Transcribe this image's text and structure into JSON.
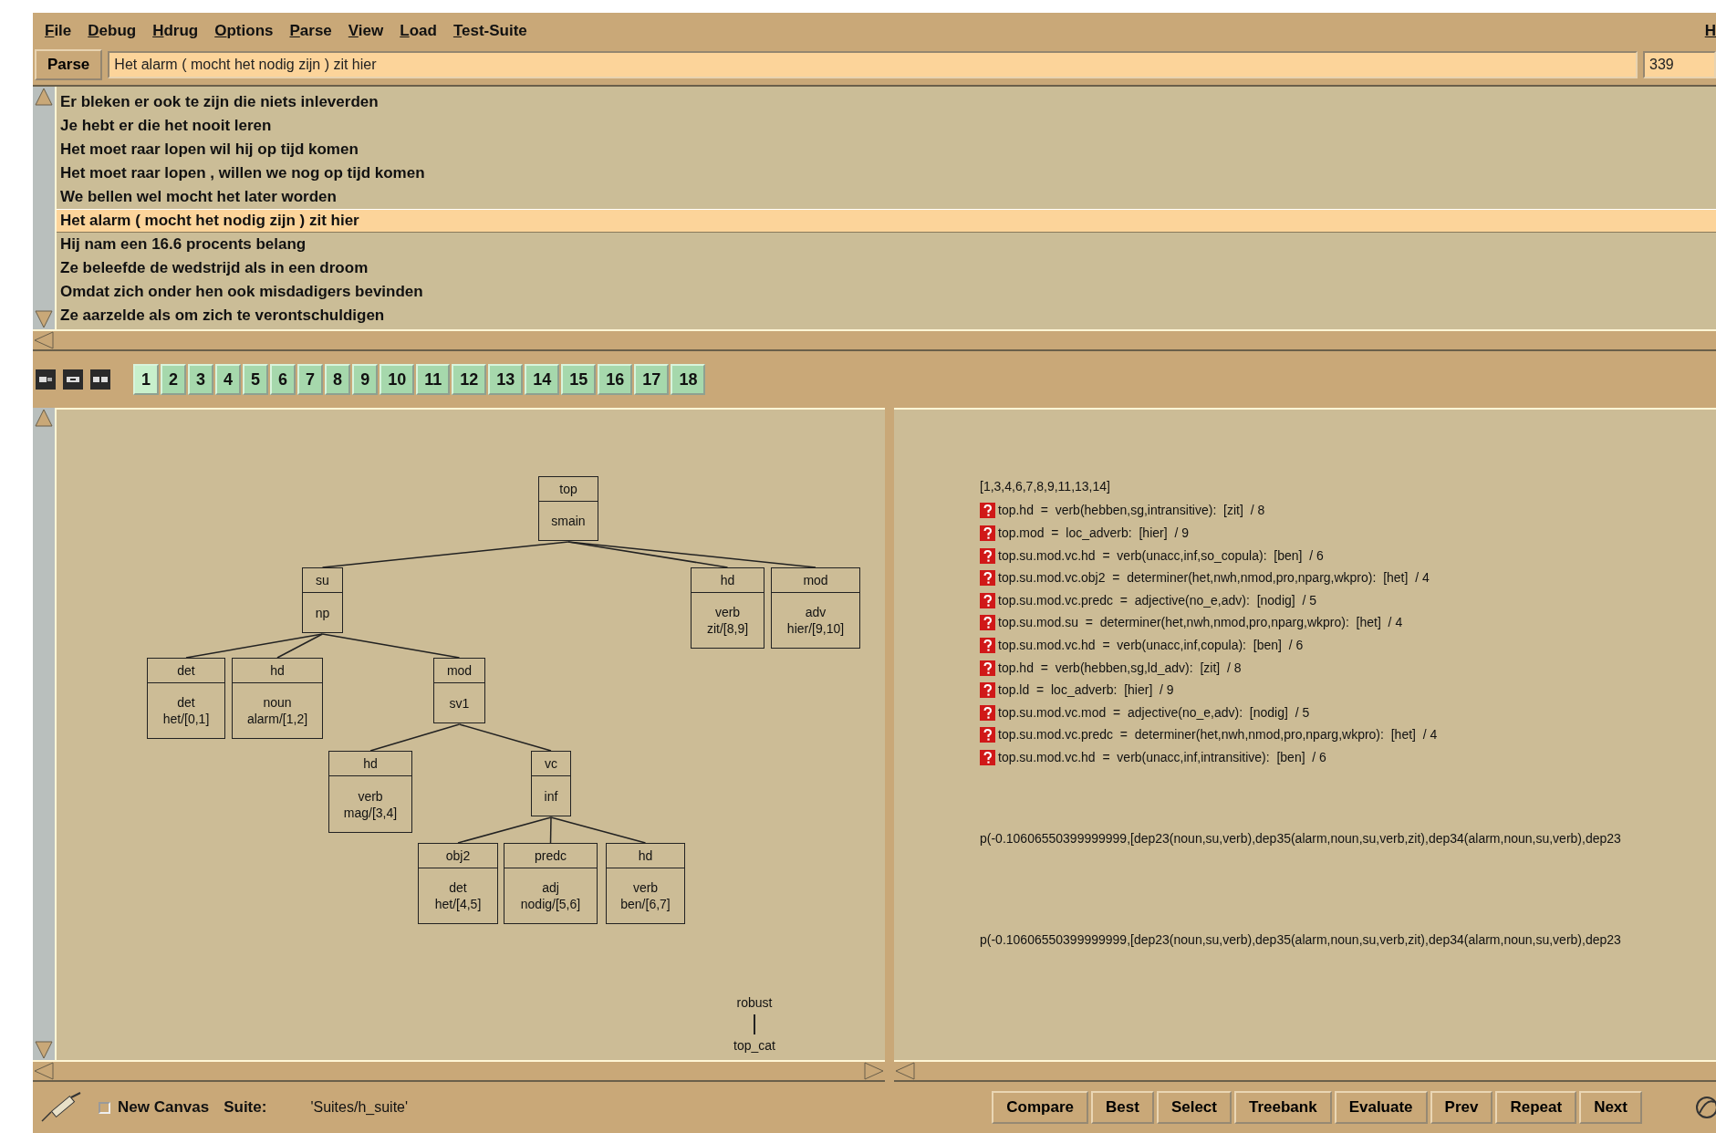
{
  "menu": [
    {
      "label": "File"
    },
    {
      "label": "Debug"
    },
    {
      "label": "Hdrug"
    },
    {
      "label": "Options"
    },
    {
      "label": "Parse"
    },
    {
      "label": "View"
    },
    {
      "label": "Load"
    },
    {
      "label": "Test-Suite"
    }
  ],
  "help_menu": "H",
  "parse": {
    "button": "Parse",
    "value": "Het alarm ( mocht het nodig zijn ) zit hier",
    "count": "339"
  },
  "sentences": [
    {
      "text": "Er bleken er ook te zijn die niets inleverden",
      "selected": false
    },
    {
      "text": "Je hebt er die het nooit leren",
      "selected": false
    },
    {
      "text": "Het moet raar lopen wil hij op tijd komen",
      "selected": false
    },
    {
      "text": "Het moet raar lopen , willen we nog op tijd komen",
      "selected": false
    },
    {
      "text": "We bellen wel mocht het later worden",
      "selected": false
    },
    {
      "text": "Het alarm ( mocht het nodig zijn ) zit hier",
      "selected": true
    },
    {
      "text": "Hij nam een 16.6 procents belang",
      "selected": false
    },
    {
      "text": "Ze beleefde de wedstrijd als in een droom",
      "selected": false
    },
    {
      "text": "Omdat zich onder hen ook misdadigers bevinden",
      "selected": false
    },
    {
      "text": "Ze aarzelde als om zich te verontschuldigen",
      "selected": false
    }
  ],
  "tabs": [
    {
      "label": "1",
      "selected": true
    },
    {
      "label": "2",
      "selected": false
    },
    {
      "label": "3",
      "selected": false
    },
    {
      "label": "4",
      "selected": false
    },
    {
      "label": "5",
      "selected": false
    },
    {
      "label": "6",
      "selected": false
    },
    {
      "label": "7",
      "selected": false
    },
    {
      "label": "8",
      "selected": false
    },
    {
      "label": "9",
      "selected": false
    },
    {
      "label": "10",
      "selected": false
    },
    {
      "label": "11",
      "selected": false
    },
    {
      "label": "12",
      "selected": false
    },
    {
      "label": "13",
      "selected": false
    },
    {
      "label": "14",
      "selected": false
    },
    {
      "label": "15",
      "selected": false
    },
    {
      "label": "16",
      "selected": false
    },
    {
      "label": "17",
      "selected": false
    },
    {
      "label": "18",
      "selected": false
    }
  ],
  "tree": {
    "rel": "top",
    "cat": "smain",
    "children": [
      {
        "rel": "su",
        "cat": "np",
        "children": [
          {
            "rel": "det",
            "cat": "det",
            "word": "het/[0,1]"
          },
          {
            "rel": "hd",
            "cat": "noun",
            "word": "alarm/[1,2]"
          },
          {
            "rel": "mod",
            "cat": "sv1",
            "children": [
              {
                "rel": "hd",
                "cat": "verb",
                "word": "mag/[3,4]"
              },
              {
                "rel": "vc",
                "cat": "inf",
                "children": [
                  {
                    "rel": "obj2",
                    "cat": "det",
                    "word": "het/[4,5]"
                  },
                  {
                    "rel": "predc",
                    "cat": "adj",
                    "word": "nodig/[5,6]"
                  },
                  {
                    "rel": "hd",
                    "cat": "verb",
                    "word": "ben/[6,7]"
                  }
                ]
              }
            ]
          }
        ]
      },
      {
        "rel": "hd",
        "cat": "verb",
        "word": "zit/[8,9]"
      },
      {
        "rel": "mod",
        "cat": "adv",
        "word": "hier/[9,10]"
      }
    ]
  },
  "robust": {
    "label": "robust",
    "child": "top_cat"
  },
  "results": {
    "header": "[1,3,4,6,7,8,9,11,13,14]",
    "items": [
      "top.hd  =  verb(hebben,sg,intransitive):  [zit]  / 8",
      "top.mod  =  loc_adverb:  [hier]  / 9",
      "top.su.mod.vc.hd  =  verb(unacc,inf,so_copula):  [ben]  / 6",
      "top.su.mod.vc.obj2  =  determiner(het,nwh,nmod,pro,nparg,wkpro):  [het]  / 4",
      "top.su.mod.vc.predc  =  adjective(no_e,adv):  [nodig]  / 5",
      "top.su.mod.su  =  determiner(het,nwh,nmod,pro,nparg,wkpro):  [het]  / 4",
      "top.su.mod.vc.hd  =  verb(unacc,inf,copula):  [ben]  / 6",
      "top.hd  =  verb(hebben,sg,ld_adv):  [zit]  / 8",
      "top.ld  =  loc_adverb:  [hier]  / 9",
      "top.su.mod.vc.mod  =  adjective(no_e,adv):  [nodig]  / 5",
      "top.su.mod.vc.predc  =  determiner(het,nwh,nmod,pro,nparg,wkpro):  [het]  / 4",
      "top.su.mod.vc.hd  =  verb(unacc,inf,intransitive):  [ben]  / 6"
    ],
    "scores": [
      "p(-0.10606550399999999,[dep23(noun,su,verb),dep35(alarm,noun,su,verb,zit),dep34(alarm,noun,su,verb),dep23",
      "p(-0.10606550399999999,[dep23(noun,su,verb),dep35(alarm,noun,su,verb,zit),dep34(alarm,noun,su,verb),dep23"
    ]
  },
  "bottom": {
    "new_canvas": {
      "label": "New Canvas",
      "checked": false
    },
    "suite_label": "Suite:",
    "suite_value": "'Suites/h_suite'",
    "buttons": [
      "Compare",
      "Best",
      "Select",
      "Treebank",
      "Evaluate",
      "Prev",
      "Repeat",
      "Next"
    ]
  }
}
